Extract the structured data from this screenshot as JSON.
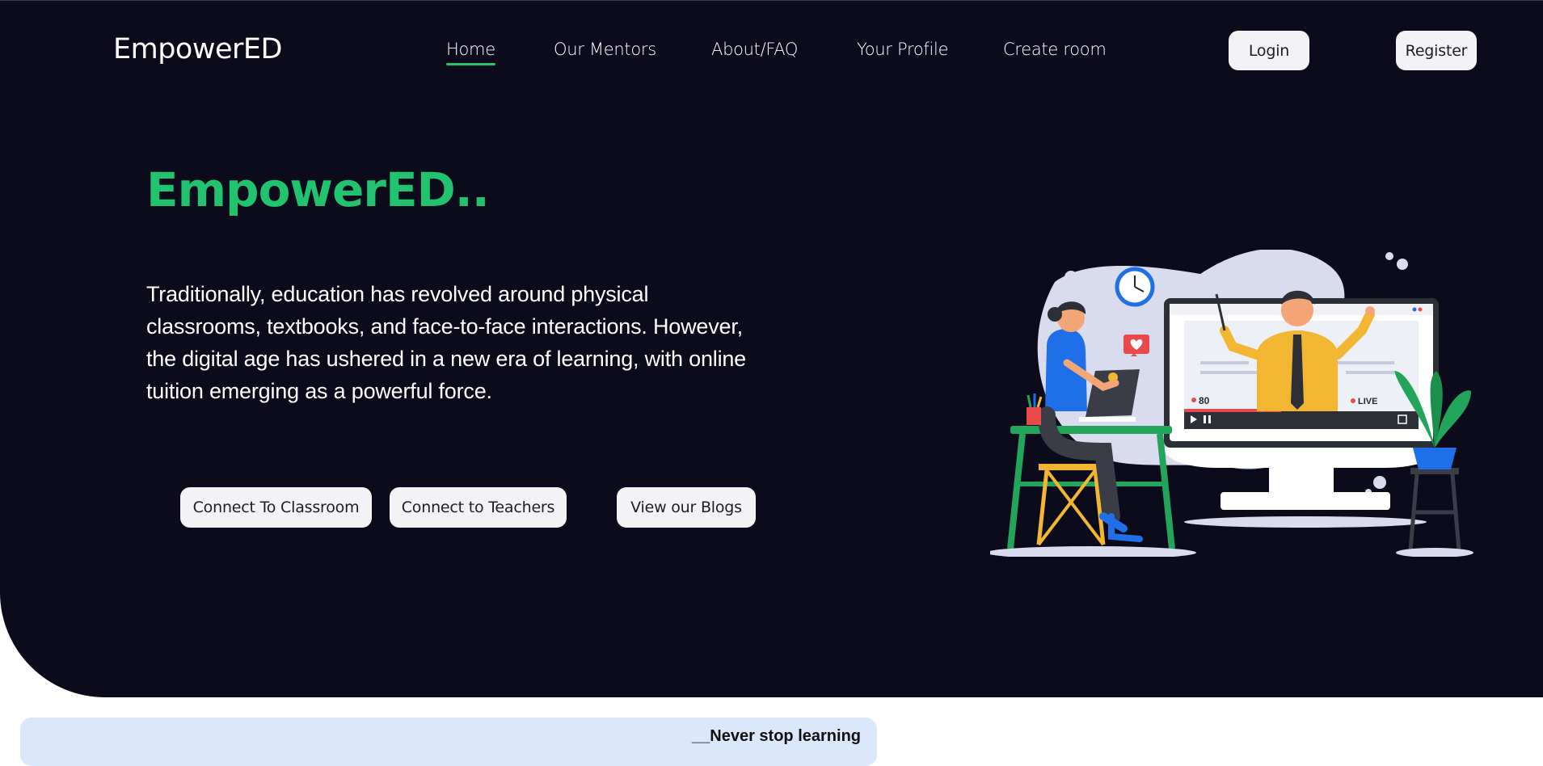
{
  "header": {
    "brand": "EmpowerED",
    "nav": [
      {
        "label": "Home",
        "active": true
      },
      {
        "label": "Our Mentors"
      },
      {
        "label": "About/FAQ"
      },
      {
        "label": "Your Profile"
      },
      {
        "label": "Create room"
      }
    ],
    "login_label": "Login",
    "register_label": "Register"
  },
  "hero": {
    "title": "EmpowerED..",
    "description": "Traditionally, education has revolved around physical classrooms, textbooks, and face-to-face interactions. However, the digital age has ushered in a new era of learning, with online tuition emerging as a powerful force.",
    "buttons": {
      "classroom": "Connect To Classroom",
      "teachers": "Connect to Teachers",
      "blogs": "View our Blogs"
    }
  },
  "illustration": {
    "viewer_count": "80",
    "live_label": "LIVE"
  },
  "footer_card": {
    "tagline": "__Never stop learning"
  },
  "colors": {
    "background": "#0b0b1b",
    "accent": "#22c36e",
    "pill": "#f3f3f5",
    "card": "#dbe8fb"
  }
}
